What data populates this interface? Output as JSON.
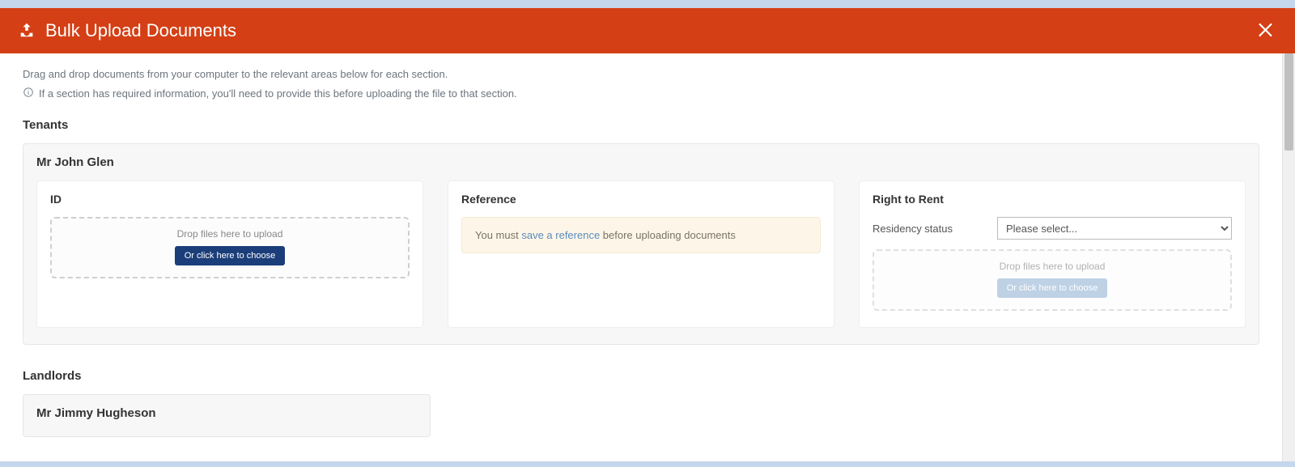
{
  "header": {
    "title": "Bulk Upload Documents"
  },
  "intro": {
    "line1": "Drag and drop documents from your computer to the relevant areas below for each section.",
    "line2": "If a section has required information, you'll need to provide this before uploading the file to that section."
  },
  "sections": {
    "tenants": {
      "title": "Tenants",
      "person": "Mr John Glen",
      "cards": {
        "id": {
          "title": "ID",
          "drop_text": "Drop files here to upload",
          "choose_label": "Or click here to choose"
        },
        "reference": {
          "title": "Reference",
          "alert_prefix": "You must ",
          "alert_link": "save a reference",
          "alert_suffix": " before uploading documents"
        },
        "right_to_rent": {
          "title": "Right to Rent",
          "field_label": "Residency status",
          "select_placeholder": "Please select...",
          "drop_text": "Drop files here to upload",
          "choose_label": "Or click here to choose"
        }
      }
    },
    "landlords": {
      "title": "Landlords",
      "person": "Mr Jimmy Hugheson"
    }
  }
}
